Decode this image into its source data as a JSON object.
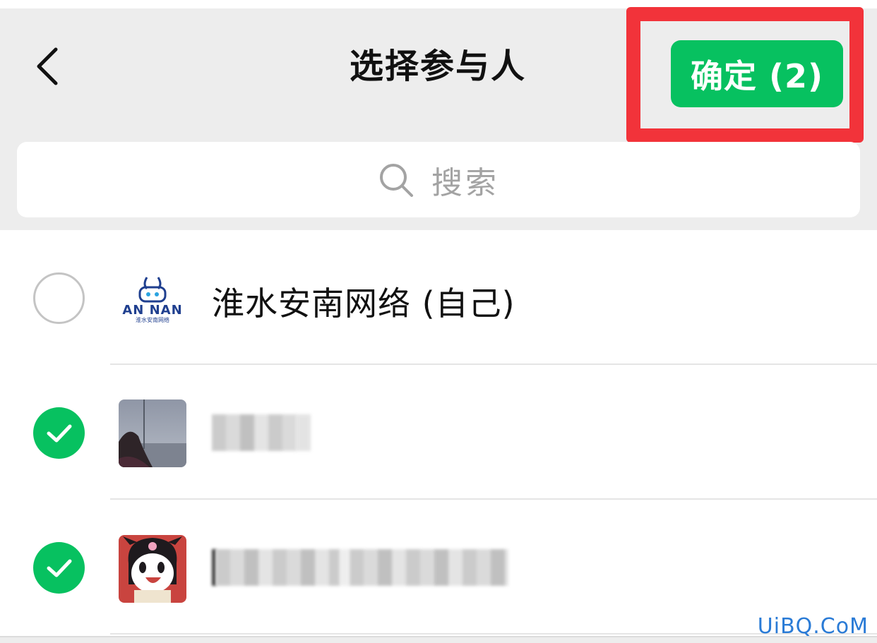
{
  "header": {
    "back_icon": "chevron-left-icon",
    "title": "选择参与人",
    "confirm_label": "确定 (2)"
  },
  "search": {
    "icon": "search-icon",
    "placeholder": "搜索"
  },
  "contacts": [
    {
      "name": "淮水安南网络 (自己)",
      "selected": false,
      "avatar": "annan-logo",
      "logo_text": "AN NAN",
      "logo_sub": "淮水安南网络"
    },
    {
      "name": "",
      "selected": true,
      "avatar": "photo-person"
    },
    {
      "name": "",
      "selected": true,
      "avatar": "cartoon-character"
    }
  ],
  "watermark": "UiBQ.CoM",
  "colors": {
    "accent_green": "#07c160",
    "highlight_red": "#f2333a",
    "header_bg": "#ededed"
  }
}
